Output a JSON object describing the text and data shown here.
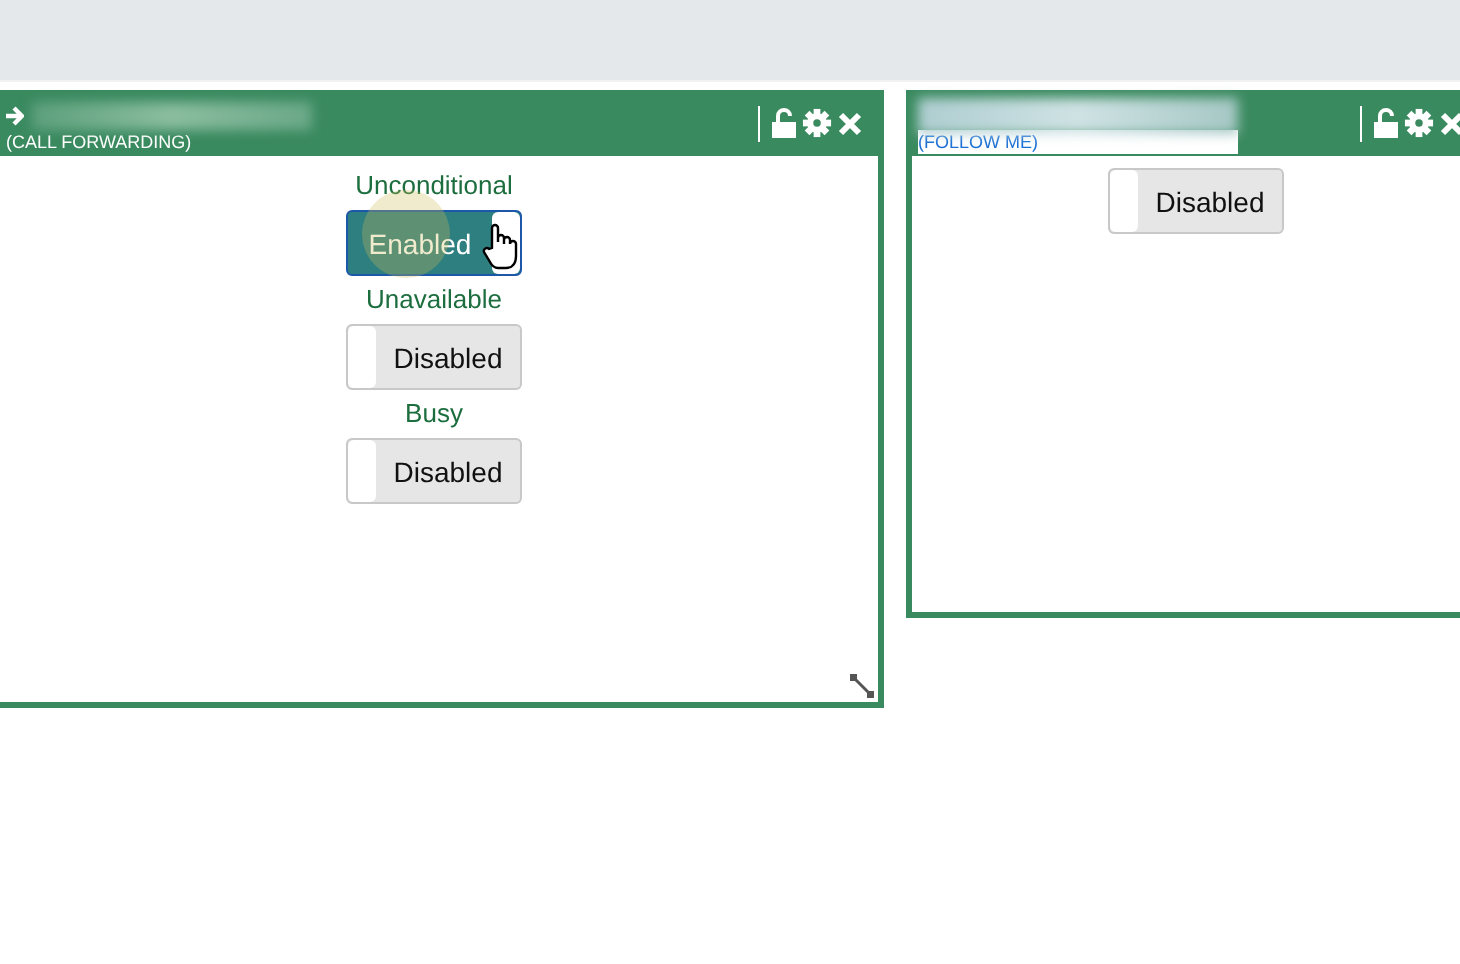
{
  "panels": [
    {
      "subtitle": "(CALL FORWARDING)",
      "subtitle_selected": false,
      "toggles": [
        {
          "label": "Unconditional",
          "state": "Enabled",
          "on": true
        },
        {
          "label": "Unavailable",
          "state": "Disabled",
          "on": false
        },
        {
          "label": "Busy",
          "state": "Disabled",
          "on": false
        }
      ]
    },
    {
      "subtitle": "(FOLLOW ME)",
      "subtitle_selected": true,
      "toggles": [
        {
          "state": "Disabled",
          "on": false
        }
      ]
    }
  ]
}
